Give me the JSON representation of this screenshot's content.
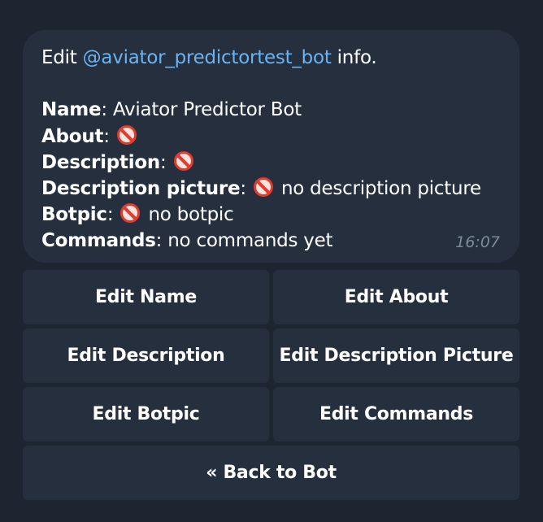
{
  "message": {
    "intro_prefix": "Edit ",
    "mention": "@aviator_predictortest_bot",
    "intro_suffix": " info.",
    "fields": {
      "name": {
        "label": "Name",
        "sep": ": ",
        "value": "Aviator Predictor Bot"
      },
      "about": {
        "label": "About",
        "sep": ": "
      },
      "description": {
        "label": "Description",
        "sep": ": "
      },
      "description_picture": {
        "label": "Description picture",
        "sep": ": ",
        "value": "no description picture"
      },
      "botpic": {
        "label": "Botpic",
        "sep": ": ",
        "value": "no botpic"
      },
      "commands": {
        "label": "Commands",
        "sep": ": ",
        "value": "no commands yet"
      }
    },
    "time": "16:07"
  },
  "keyboard": {
    "edit_name": "Edit Name",
    "edit_about": "Edit About",
    "edit_description": "Edit Description",
    "edit_description_picture": "Edit Description Picture",
    "edit_botpic": "Edit Botpic",
    "edit_commands": "Edit Commands",
    "back_to_bot": "« Back to Bot"
  },
  "icons": {
    "empty_marker": "no-entry-icon"
  },
  "colors": {
    "background": "#1c2530",
    "bubble": "#252f3e",
    "mention": "#6ab3f3",
    "time": "#7d8a99",
    "no_entry": "#e23b2e"
  }
}
